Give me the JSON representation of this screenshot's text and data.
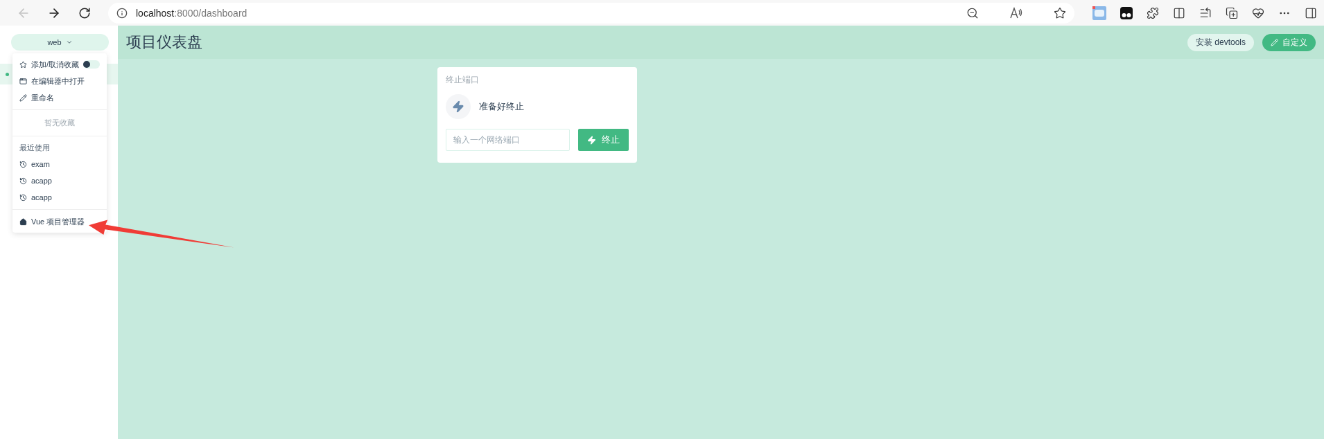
{
  "browser": {
    "back": {
      "disabled": true
    },
    "forward": {
      "disabled": false
    },
    "address": {
      "host": "localhost",
      "rest": ":8000/dashboard"
    }
  },
  "project_switcher": {
    "label": "web"
  },
  "project_menu": {
    "actions": [
      {
        "kind": "favorite",
        "label": "添加/取消收藏",
        "toggle_on": false
      },
      {
        "kind": "open_editor",
        "label": "在编辑器中打开"
      },
      {
        "kind": "rename",
        "label": "重命名"
      }
    ],
    "empty_favorites": "暂无收藏",
    "recent_heading": "最近使用",
    "recent": [
      "exam",
      "acapp",
      "acapp"
    ],
    "home": "Vue 项目管理器"
  },
  "header": {
    "title": "项目仪表盘",
    "buttons": [
      {
        "kind": "secondary",
        "label": "安装 devtools"
      },
      {
        "kind": "primary",
        "label": "自定义"
      }
    ]
  },
  "widget": {
    "title": "终止端口",
    "status": "准备好终止",
    "input": {
      "placeholder": "输入一个网络端口"
    },
    "button": "终止"
  }
}
